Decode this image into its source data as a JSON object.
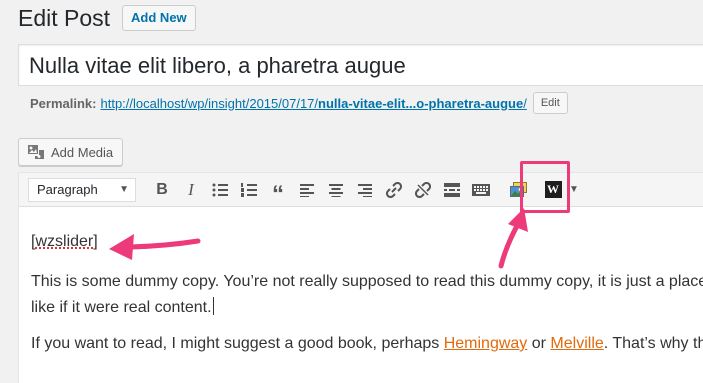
{
  "header": {
    "title": "Edit Post",
    "add_new": "Add New"
  },
  "post": {
    "title": "Nulla vitae elit libero, a pharetra augue"
  },
  "permalink": {
    "label": "Permalink:",
    "url_prefix": "http://localhost/wp/insight/2015/07/17/",
    "slug": "nulla-vitae-elit...o-pharetra-augue",
    "suffix": "/",
    "edit_label": "Edit"
  },
  "media": {
    "add_media_label": "Add Media"
  },
  "toolbar": {
    "format_value": "Paragraph",
    "buttons": [
      "bold",
      "italic",
      "bullet-list",
      "numbered-list",
      "blockquote",
      "align-left",
      "align-center",
      "align-right",
      "link",
      "unlink",
      "read-more",
      "toolbar-toggle",
      "insert-slider",
      "wordpress"
    ]
  },
  "content": {
    "shortcode_open": "[",
    "shortcode_word": "wzslider",
    "shortcode_close": "]",
    "para1_line1": "This is some dummy copy. You’re not really supposed to read this dummy copy, it is just a place",
    "para1_line2": "like if it were real content.",
    "para2_start": "If you want to read, I might suggest a good book, perhaps ",
    "link1": "Hemingway",
    "para2_mid": " or ",
    "link2": "Melville",
    "para2_end": ". That’s why they"
  },
  "annotation": {
    "color": "#ec3a7a"
  }
}
